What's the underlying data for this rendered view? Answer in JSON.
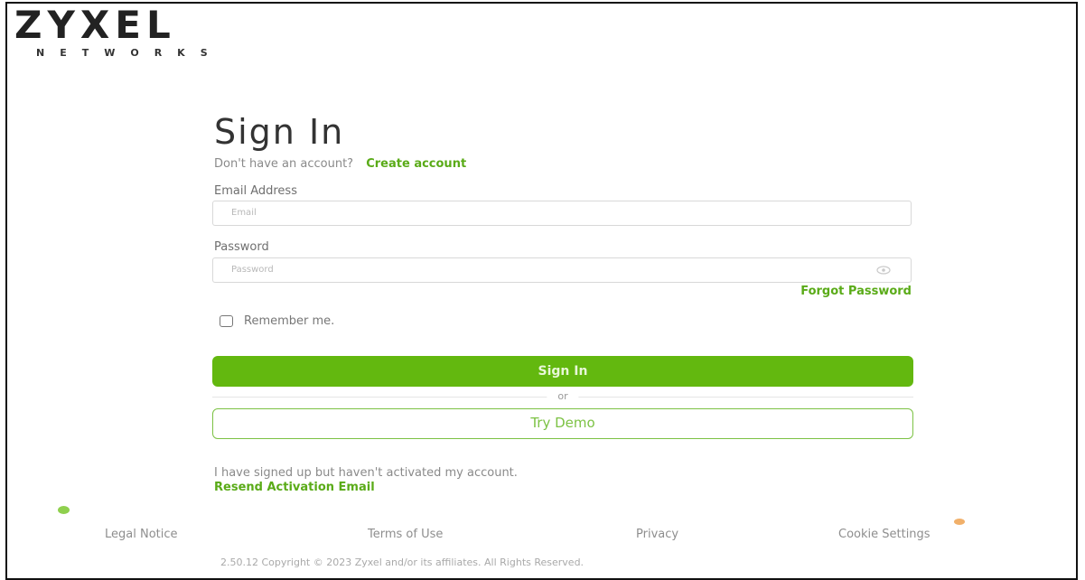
{
  "logo": {
    "main": "ZYXEL",
    "sub": "NETWORKS"
  },
  "signin": {
    "title": "Sign In",
    "no_account_text": "Don't have an account?",
    "create_account_link": "Create account",
    "email_label": "Email Address",
    "email_placeholder": "Email",
    "email_value": "",
    "password_label": "Password",
    "password_placeholder": "Password",
    "password_value": "",
    "forgot_password_link": "Forgot Password",
    "remember_me_label": "Remember me.",
    "remember_me_checked": false,
    "signin_button": "Sign In",
    "or_text": "or",
    "try_demo_button": "Try Demo",
    "activation_text": "I have signed up but haven't activated my account.",
    "resend_link": "Resend Activation Email"
  },
  "footer": {
    "links": [
      "Legal Notice",
      "Terms of Use",
      "Privacy",
      "Cookie Settings"
    ],
    "copyright": "2.50.12 Copyright © 2023 Zyxel and/or its affiliates. All Rights Reserved."
  },
  "colors": {
    "accent_green": "#63b80f",
    "link_green": "#5aab18",
    "dot_green": "#8fd04e",
    "dot_orange": "#f1b06a"
  },
  "icons": {
    "password_toggle": "eye-icon"
  }
}
